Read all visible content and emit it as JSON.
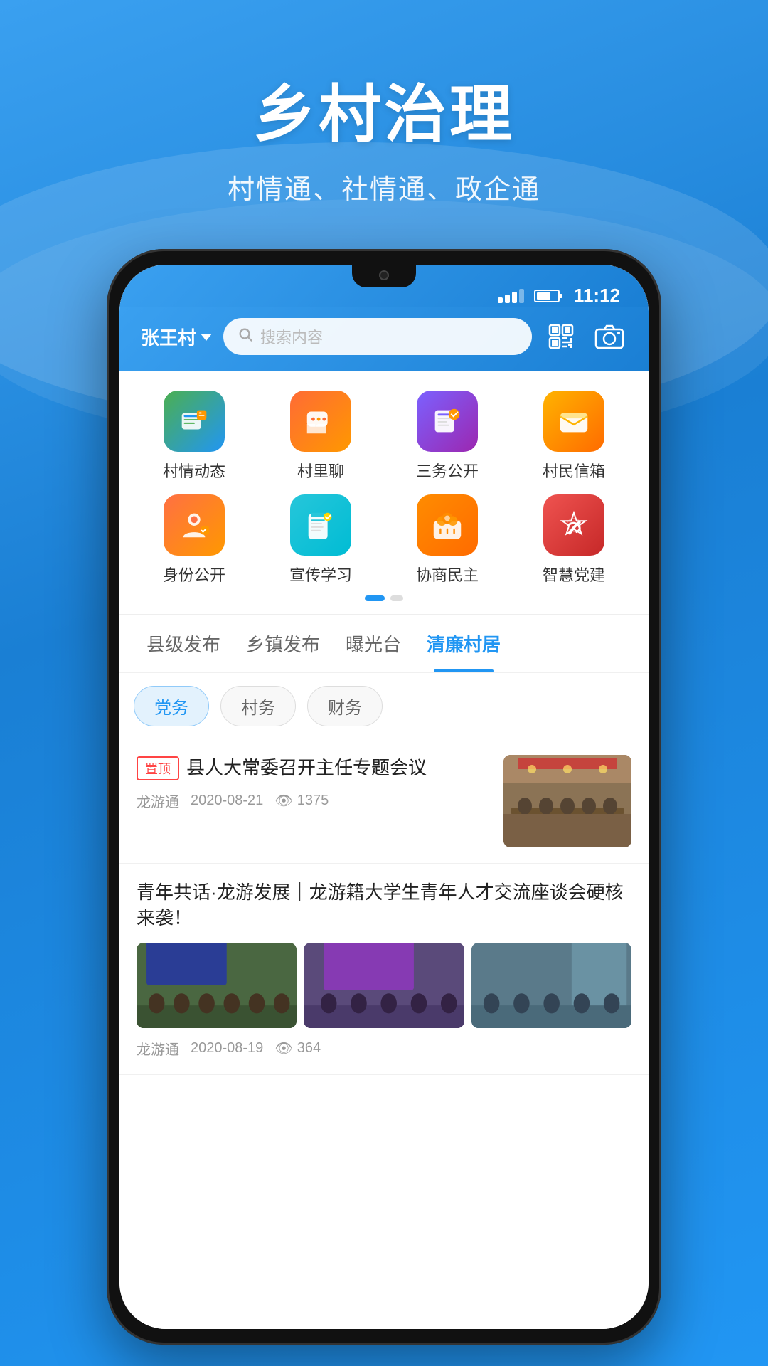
{
  "app": {
    "title": "乡村治理",
    "subtitle": "村情通、社情通、政企通"
  },
  "status_bar": {
    "time": "11:12"
  },
  "nav": {
    "village_name": "张王村",
    "search_placeholder": "搜索内容"
  },
  "menu_items": [
    {
      "id": "village-news",
      "label": "村情动态",
      "icon_type": "village-news"
    },
    {
      "id": "village-chat",
      "label": "村里聊",
      "icon_type": "chat"
    },
    {
      "id": "public-affairs",
      "label": "三务公开",
      "icon_type": "public"
    },
    {
      "id": "mailbox",
      "label": "村民信箱",
      "icon_type": "mailbox"
    },
    {
      "id": "identity",
      "label": "身份公开",
      "icon_type": "identity"
    },
    {
      "id": "study",
      "label": "宣传学习",
      "icon_type": "study"
    },
    {
      "id": "democracy",
      "label": "协商民主",
      "icon_type": "demo"
    },
    {
      "id": "party",
      "label": "智慧党建",
      "icon_type": "party"
    }
  ],
  "main_tabs": [
    {
      "id": "county",
      "label": "县级发布",
      "active": false
    },
    {
      "id": "town",
      "label": "乡镇发布",
      "active": false
    },
    {
      "id": "expose",
      "label": "曝光台",
      "active": false
    },
    {
      "id": "clean",
      "label": "清廉村居",
      "active": true
    }
  ],
  "sub_tabs": [
    {
      "id": "party-affairs",
      "label": "党务",
      "active": true
    },
    {
      "id": "village-affairs",
      "label": "村务",
      "active": false
    },
    {
      "id": "finance",
      "label": "财务",
      "active": false
    }
  ],
  "news_items": [
    {
      "id": "news-1",
      "pinned": true,
      "pinned_label": "置顶",
      "title": "县人大常委召开主任专题会议",
      "source": "龙游通",
      "date": "2020-08-21",
      "views": "1375",
      "has_image": true
    },
    {
      "id": "news-2",
      "pinned": false,
      "title": "青年共话·龙游发展｜龙游籍大学生青年人才交流座谈会硬核来袭！",
      "source": "龙游通",
      "date": "2020-08-19",
      "views": "364",
      "has_images": true
    }
  ]
}
